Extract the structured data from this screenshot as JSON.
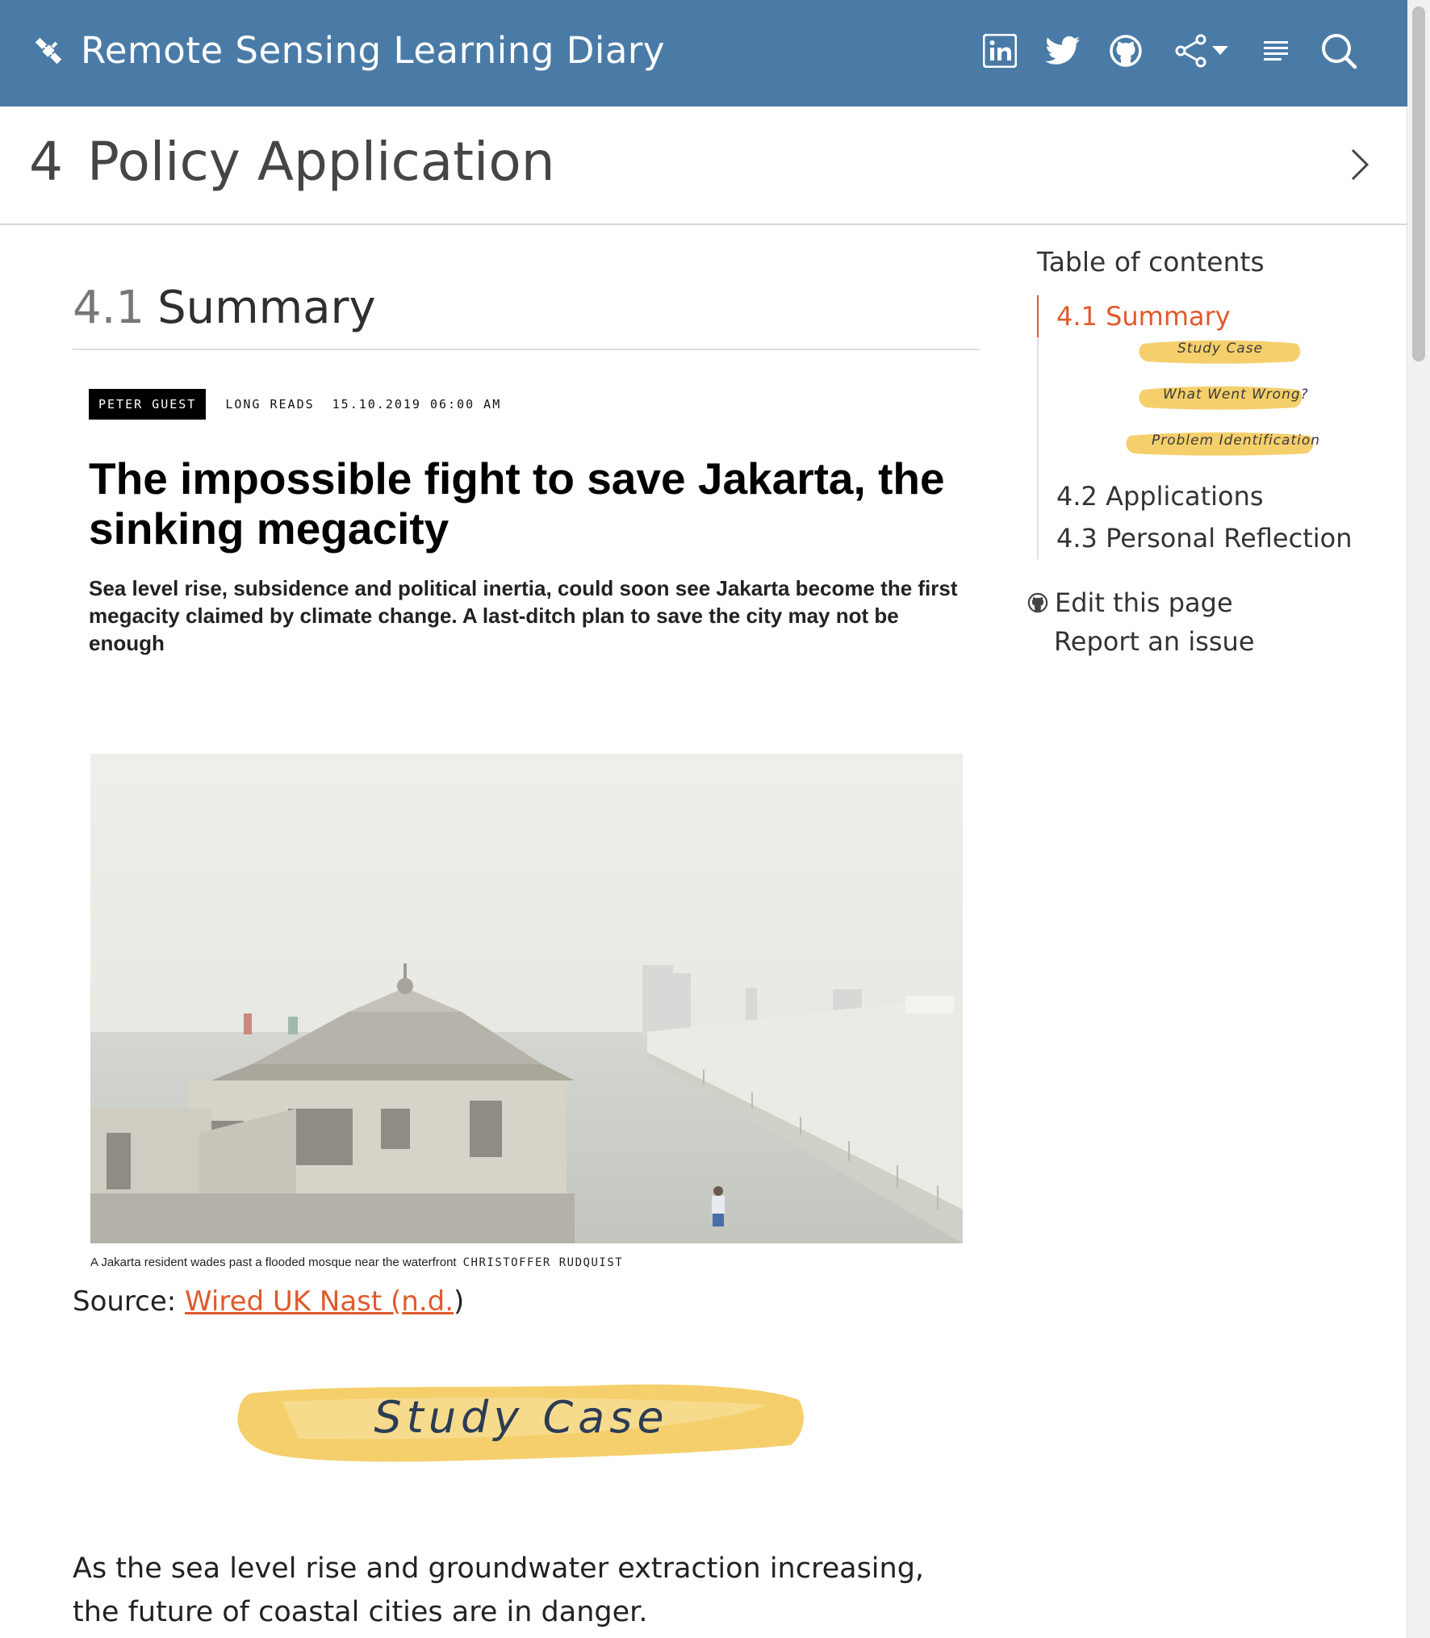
{
  "header": {
    "title": "Remote Sensing Learning Diary",
    "icons": [
      "satellite-icon",
      "linkedin-icon",
      "twitter-icon",
      "github-icon",
      "share-icon",
      "toc-icon",
      "search-icon"
    ]
  },
  "page": {
    "chapter_number": "4",
    "chapter_title": "Policy Application"
  },
  "section": {
    "number": "4.1",
    "title": "Summary"
  },
  "article": {
    "author": "PETER GUEST",
    "category": "LONG READS",
    "datetime": "15.10.2019 06:00 AM",
    "title": "The impossible fight to save Jakarta, the sinking megacity",
    "dek": "Sea level rise, subsidence and political inertia, could soon see Jakarta become the first megacity claimed by climate change. A last-ditch plan to save the city may not be enough",
    "caption": "A Jakarta resident wades past a flooded mosque near the waterfront",
    "credit": "CHRISTOFFER RUDQUIST"
  },
  "source": {
    "prefix": "Source: ",
    "link_text": "Wired UK Nast (n.d.",
    "suffix": ")"
  },
  "study_case_heading": "Study Case",
  "body": {
    "paragraph": "As the sea level rise and groundwater extraction increasing, the future of coastal cities are in danger."
  },
  "toc": {
    "title": "Table of contents",
    "items": [
      {
        "label": "4.1 Summary",
        "active": true
      },
      {
        "label": "4.2 Applications"
      },
      {
        "label": "4.3 Personal Reflection"
      }
    ],
    "sub_items": [
      "Study Case",
      "What Went Wrong?",
      "Problem Identification"
    ],
    "edit_link": "Edit this page",
    "issue_link": "Report an issue"
  },
  "colors": {
    "navbar": "#4a7ba7",
    "accent": "#e05a2b",
    "highlight": "#f5cf6b"
  }
}
